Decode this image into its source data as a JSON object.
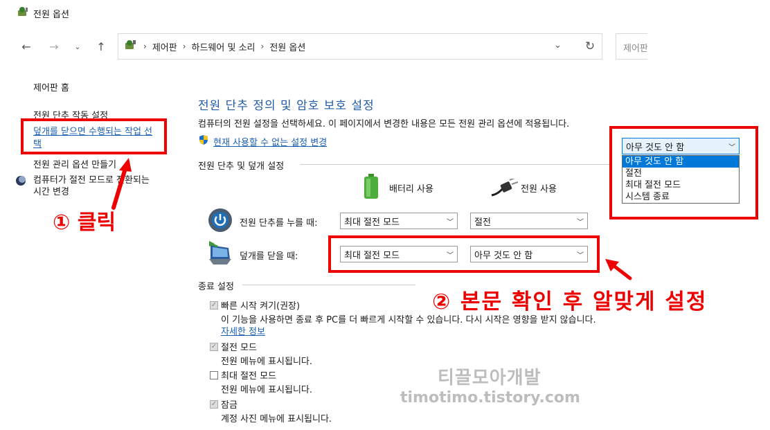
{
  "window": {
    "title": "전원 옵션"
  },
  "addressbar": {
    "crumbs": [
      "제어판",
      "하드웨어 및 소리",
      "전원 옵션"
    ],
    "search_placeholder": "제어판"
  },
  "sidebar": {
    "home": "제어판 홈",
    "items": [
      "전원 단추 작동 설정",
      "덮개를 닫으면 수행되는 작업 선택",
      "전원 관리 옵션 만들기",
      "컴퓨터가 절전 모드로 전환되는 시간 변경"
    ]
  },
  "main": {
    "title": "전원 단추 정의 및 암호 보호 설정",
    "description": "컴퓨터의 전원 설정을 선택하세요. 이 페이지에서 변경한 내용은 모든 전원 관리 옵션에 적용됩니다.",
    "unavailable_link": "현재 사용할 수 없는 설정 변경",
    "section_power": "전원 단추 및 덮개 설정",
    "col_battery": "배터리 사용",
    "col_plugged": "전원 사용",
    "row_power_button": {
      "label": "전원 단추를 누를 때:",
      "battery": "최대 절전 모드",
      "plugged": "절전"
    },
    "row_lid": {
      "label": "덮개를 닫을 때:",
      "battery": "최대 절전 모드",
      "plugged": "아무 것도 안 함"
    },
    "section_shutdown": "종료 설정",
    "fast_startup": {
      "label": "빠른 시작 켜기(권장)",
      "desc": "이 기능을 사용하면 종료 후 PC를 더 빠르게 시작할 수 있습니다. 다시 시작은 영향을 받지 않습니다.",
      "link": "자세한 정보"
    },
    "sleep": {
      "label": "절전 모드",
      "desc": "전원 메뉴에 표시됩니다."
    },
    "hibernate": {
      "label": "최대 절전 모드",
      "desc": "전원 메뉴에 표시됩니다."
    },
    "lock": {
      "label": "잠금",
      "desc": "계정 사진 메뉴에 표시됩니다."
    }
  },
  "popup": {
    "selected": "아무 것도 안 함",
    "options": [
      "아무 것도 안 함",
      "절전",
      "최대 절전 모드",
      "시스템 종료"
    ]
  },
  "annotations": {
    "step1": "① 클릭",
    "step2": "② 본문 확인 후 알맞게 설정"
  },
  "watermark": {
    "line1": "티끌모아개발",
    "line2": "timotimo.tistory.com"
  },
  "colors": {
    "accent_title": "#1f5ca8",
    "link": "#1a5fb4",
    "annotation_red": "#ee0000",
    "selected_option": "#0078d7"
  }
}
